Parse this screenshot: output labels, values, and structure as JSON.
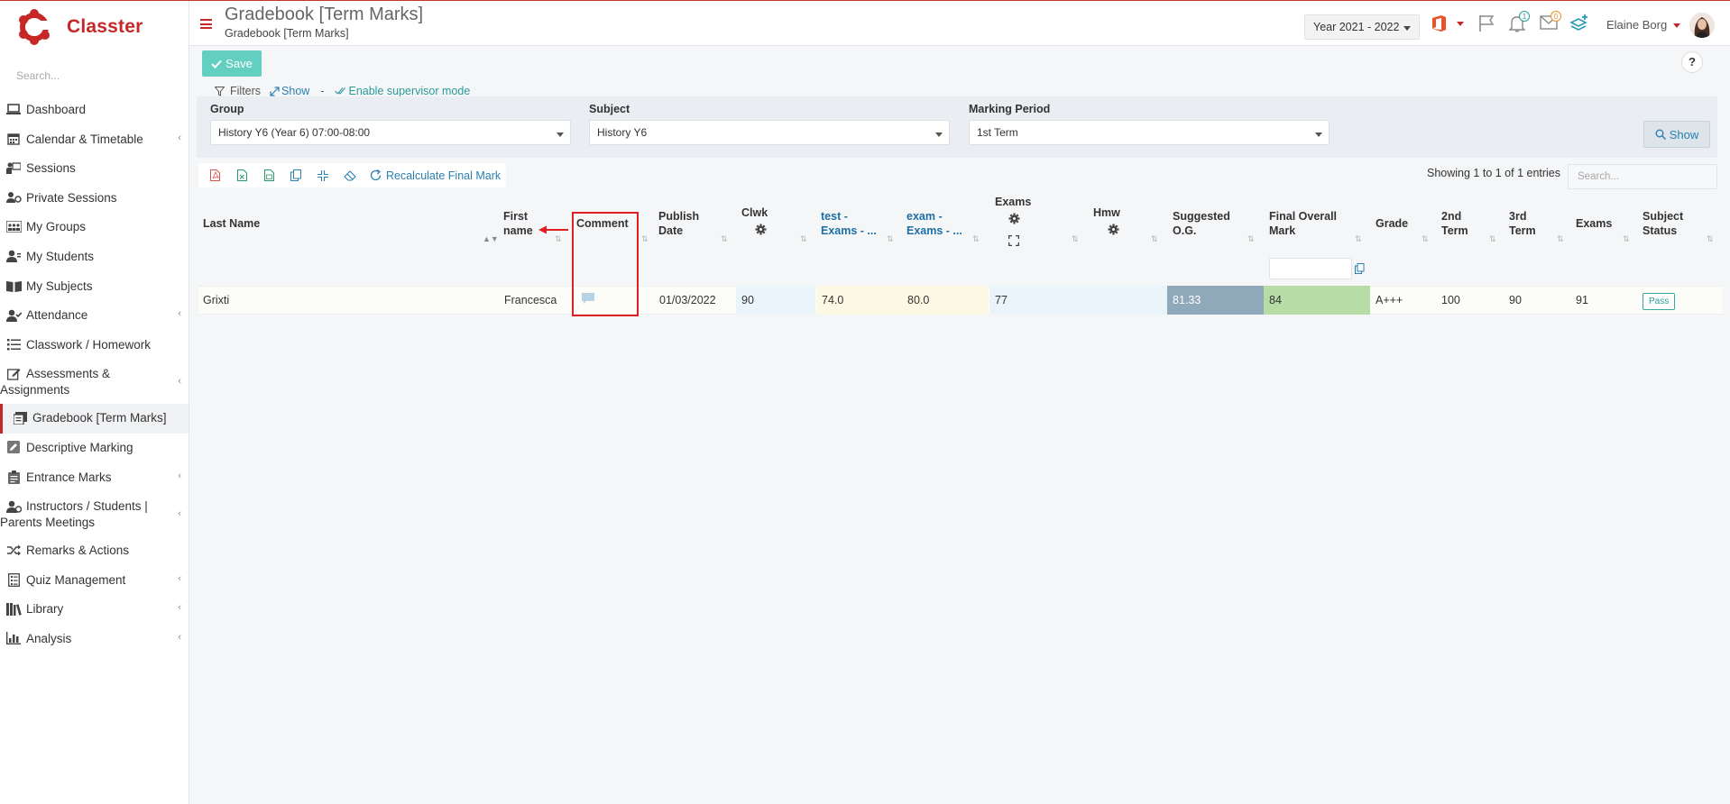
{
  "app": {
    "name": "Classter"
  },
  "sidebar": {
    "search_placeholder": "Search...",
    "items": [
      {
        "label": "Dashboard",
        "icon": "laptop-icon",
        "has_children": false
      },
      {
        "label": "Calendar & Timetable",
        "icon": "calendar-icon",
        "has_children": true
      },
      {
        "label": "Sessions",
        "icon": "presentation-icon",
        "has_children": false
      },
      {
        "label": "Private Sessions",
        "icon": "users-gear-icon",
        "has_children": false
      },
      {
        "label": "My Groups",
        "icon": "groups-icon",
        "has_children": false
      },
      {
        "label": "My Students",
        "icon": "user-icon",
        "has_children": false
      },
      {
        "label": "My Subjects",
        "icon": "book-open-icon",
        "has_children": false
      },
      {
        "label": "Attendance",
        "icon": "user-check-icon",
        "has_children": true
      },
      {
        "label": "Classwork / Homework",
        "icon": "list-icon",
        "has_children": false
      },
      {
        "label": "Assessments & Assignments",
        "icon": "edit-icon",
        "has_children": true
      },
      {
        "label": "Gradebook [Term Marks]",
        "icon": "gradebook-icon",
        "has_children": false,
        "active": true
      },
      {
        "label": "Descriptive Marking",
        "icon": "pencil-square-icon",
        "has_children": false
      },
      {
        "label": "Entrance Marks",
        "icon": "clipboard-icon",
        "has_children": true
      },
      {
        "label": "Instructors / Students | Parents Meetings",
        "icon": "user-meeting-icon",
        "has_children": true
      },
      {
        "label": "Remarks & Actions",
        "icon": "shuffle-icon",
        "has_children": false
      },
      {
        "label": "Quiz Management",
        "icon": "quiz-icon",
        "has_children": true
      },
      {
        "label": "Library",
        "icon": "library-icon",
        "has_children": true
      },
      {
        "label": "Analysis",
        "icon": "bar-chart-icon",
        "has_children": true
      }
    ]
  },
  "header": {
    "title": "Gradebook [Term Marks]",
    "subtitle": "Gradebook [Term Marks]",
    "year": "Year 2021 - 2022",
    "notifications_count": "1",
    "messages_count": "0",
    "user_name": "Elaine Borg"
  },
  "toolbar": {
    "save_label": "Save",
    "help_label": "?"
  },
  "filters": {
    "label": "Filters",
    "show_link": "Show",
    "separator": "-",
    "supervisor_link": "Enable supervisor mode",
    "group": {
      "label": "Group",
      "value": "History Y6 (Year 6) 07:00-08:00"
    },
    "subject": {
      "label": "Subject",
      "value": "History Y6"
    },
    "marking_period": {
      "label": "Marking Period",
      "value": "1st Term"
    },
    "show_button": "Show"
  },
  "table_tools": {
    "recalculate_label": "Recalculate Final Mark",
    "entries_text": "Showing 1 to 1 of 1 entries",
    "search_placeholder": "Search..."
  },
  "table": {
    "headers": {
      "last_name": "Last Name",
      "first_name_1": "First",
      "first_name_2": "name",
      "comment": "Comment",
      "publish_1": "Publish",
      "publish_2": "Date",
      "clwk": "Clwk",
      "test_1": "test -",
      "test_2": "Exams - ...",
      "exam_1": "exam -",
      "exam_2": "Exams - ...",
      "exams": "Exams",
      "hmw": "Hmw",
      "suggested_1": "Suggested",
      "suggested_2": "O.G.",
      "final_1": "Final Overall",
      "final_2": "Mark",
      "grade": "Grade",
      "term2_1": "2nd",
      "term2_2": "Term",
      "term3_1": "3rd",
      "term3_2": "Term",
      "exams2": "Exams",
      "status_1": "Subject",
      "status_2": "Status"
    },
    "rows": [
      {
        "last_name": "Grixti",
        "first_name": "Francesca",
        "publish_date": "01/03/2022",
        "clwk": "90",
        "test": "74.0",
        "exam": "80.0",
        "exams": "77",
        "hmw": "",
        "suggested": "81.33",
        "final": "84",
        "grade": "A+++",
        "term2": "100",
        "term3": "90",
        "exams2": "91",
        "status": "Pass"
      }
    ]
  },
  "colors": {
    "brand": "#c62828",
    "accent": "#2a9a9a",
    "save_button": "#63cfc1",
    "suggested_bg": "#8fa9bb",
    "final_bg": "#b7dca5",
    "clwk_bg": "#eaf5fb",
    "test_bg": "#fdf8e3"
  }
}
